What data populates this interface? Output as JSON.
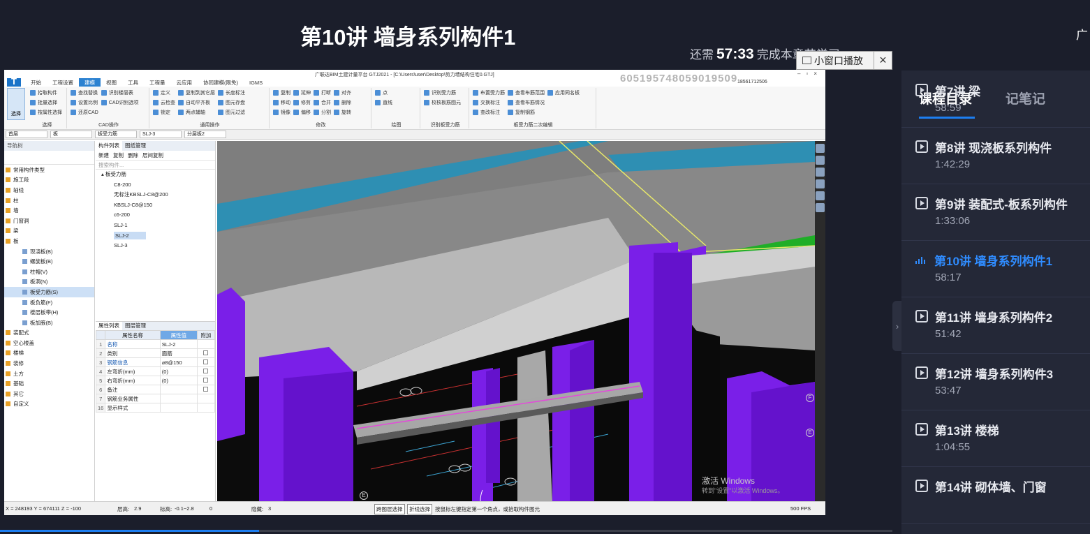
{
  "header": {
    "course_title": "第10讲 墙身系列构件1",
    "right_cut_text": "广",
    "remain_prefix": "还需",
    "remain_time": "57:33",
    "remain_suffix": "完成本章节学习",
    "pip_label": "小窗口播放",
    "pip_close": "×"
  },
  "app": {
    "title": "广联达BIM土建计量平台 GTJ2021 - [C:\\Users\\user\\Desktop\\剪力墙结构住宅0.GTJ]",
    "watermark": "605195748059019509",
    "phone": "18561712506",
    "logo": "T",
    "menu": [
      "开始",
      "工程设置",
      "建模",
      "视图",
      "工具",
      "工程量",
      "云应用",
      "协同建模(限免)",
      "IGMS"
    ],
    "active_menu": "建模",
    "ribbon_groups": [
      {
        "name": "选择",
        "rows": [
          "拾取构件",
          "批量选择",
          "按属性选择"
        ]
      },
      {
        "name": "CAD操作",
        "rows": [
          "查找替换",
          "设置比例",
          "还原CAD",
          "识别楼层表",
          "CAD识别选项"
        ]
      },
      {
        "name": "通用操作",
        "rows": [
          "定义",
          "云检查",
          "锁定",
          "复制到其它层",
          "自动平齐板",
          "两点辅轴",
          "长度标注",
          "图元存盘",
          "图元过滤"
        ]
      },
      {
        "name": "修改",
        "rows": [
          "复制",
          "移动",
          "镜像",
          "延伸",
          "修剪",
          "偏移",
          "打断",
          "合并",
          "分割",
          "对齐",
          "删除",
          "旋转"
        ]
      },
      {
        "name": "绘图",
        "rows": [
          "点",
          "直线"
        ]
      },
      {
        "name": "识别板受力筋",
        "rows": [
          "识别受力筋",
          "校核板筋图元"
        ]
      },
      {
        "name": "板受力筋二次编辑",
        "rows": [
          "布置受力筋",
          "交换标注",
          "查改标注",
          "查看布筋范围",
          "查看布筋情况",
          "复制钢筋",
          "应用同名板"
        ]
      }
    ],
    "select_label": "选择",
    "dropdowns": [
      "首层",
      "板",
      "板受力筋",
      "SLJ-3",
      "分层板2"
    ]
  },
  "navtree": {
    "header": "导航树",
    "items": [
      {
        "label": "常用构件类型",
        "sub": false
      },
      {
        "label": "施工段",
        "sub": false
      },
      {
        "label": "轴线",
        "sub": false
      },
      {
        "label": "柱",
        "sub": false
      },
      {
        "label": "墙",
        "sub": false
      },
      {
        "label": "门窗洞",
        "sub": false
      },
      {
        "label": "梁",
        "sub": false
      },
      {
        "label": "板",
        "sub": false
      },
      {
        "label": "现浇板(B)",
        "sub": true
      },
      {
        "label": "螺旋板(B)",
        "sub": true
      },
      {
        "label": "柱帽(V)",
        "sub": true
      },
      {
        "label": "板洞(N)",
        "sub": true
      },
      {
        "label": "板受力筋(S)",
        "sub": true,
        "selected": true
      },
      {
        "label": "板负筋(F)",
        "sub": true
      },
      {
        "label": "楼层板带(H)",
        "sub": true
      },
      {
        "label": "板加腋(B)",
        "sub": true
      },
      {
        "label": "装配式",
        "sub": false
      },
      {
        "label": "空心楼盖",
        "sub": false
      },
      {
        "label": "楼梯",
        "sub": false
      },
      {
        "label": "装修",
        "sub": false
      },
      {
        "label": "土方",
        "sub": false
      },
      {
        "label": "基础",
        "sub": false
      },
      {
        "label": "其它",
        "sub": false
      },
      {
        "label": "自定义",
        "sub": false
      }
    ]
  },
  "complist": {
    "tabs": [
      "构件列表",
      "图纸管理"
    ],
    "actions": [
      "新建",
      "复制",
      "删除",
      "层间复制"
    ],
    "search_placeholder": "搜索构件...",
    "root": "板受力筋",
    "items": [
      "C8-200",
      "无标注KBSLJ-C8@200",
      "KBSLJ-C8@150",
      "c6-200",
      "SLJ-1",
      "SLJ-2",
      "SLJ-3"
    ],
    "selected": "SLJ-2"
  },
  "props": {
    "tabs": [
      "属性列表",
      "图层管理"
    ],
    "columns": [
      "属性名称",
      "属性值",
      "附加"
    ],
    "rows": [
      {
        "n": "1",
        "name": "名称",
        "value": "SLJ-2",
        "blue": true,
        "cb": false
      },
      {
        "n": "2",
        "name": "类别",
        "value": "面筋",
        "blue": false,
        "cb": true
      },
      {
        "n": "3",
        "name": "钢筋信息",
        "value": "⌀8@150",
        "blue": true,
        "cb": true
      },
      {
        "n": "4",
        "name": "左弯折(mm)",
        "value": "(0)",
        "blue": false,
        "cb": true
      },
      {
        "n": "5",
        "name": "右弯折(mm)",
        "value": "(0)",
        "blue": false,
        "cb": true
      },
      {
        "n": "6",
        "name": "备注",
        "value": "",
        "blue": false,
        "cb": true
      },
      {
        "n": "7",
        "name": "钢筋业务属性",
        "value": "",
        "blue": false,
        "cb": false
      },
      {
        "n": "16",
        "name": "显示样式",
        "value": "",
        "blue": false,
        "cb": false
      }
    ]
  },
  "viewport": {
    "axis_labels": [
      "F",
      "E",
      "E"
    ]
  },
  "statusbar": {
    "coords": "X = 248193 Y = 674111 Z = -100",
    "floor_height_label": "层高:",
    "floor_height": "2.9",
    "elevation_label": "标高:",
    "elevation": "-0.1~2.8",
    "zero": "0",
    "hidden_label": "隐藏:",
    "hidden": "3",
    "cross_layer": "跨图层选择",
    "polyline": "折线选择",
    "hint": "按鼠标左键指定第一个角点，或拾取构件图元",
    "fps": "500 FPS"
  },
  "windows_activate": {
    "line1": "激活 Windows",
    "line2": "转到\"设置\"以激活 Windows。"
  },
  "progress": 0.29,
  "sidebar": {
    "tab_catalog": "课程目录",
    "tab_notes": "记笔记",
    "lessons": [
      {
        "title": "第7讲 梁",
        "duration": "58:59",
        "active": false
      },
      {
        "title": "第8讲 现浇板系列构件",
        "duration": "1:42:29",
        "active": false
      },
      {
        "title": "第9讲 装配式-板系列构件",
        "duration": "1:33:06",
        "active": false
      },
      {
        "title": "第10讲 墙身系列构件1",
        "duration": "58:17",
        "active": true
      },
      {
        "title": "第11讲 墙身系列构件2",
        "duration": "51:42",
        "active": false
      },
      {
        "title": "第12讲 墙身系列构件3",
        "duration": "53:47",
        "active": false
      },
      {
        "title": "第13讲 楼梯",
        "duration": "1:04:55",
        "active": false
      },
      {
        "title": "第14讲 砌体墙、门窗",
        "duration": "",
        "active": false
      }
    ]
  },
  "colors": {
    "accent": "#1d7ef0",
    "active_lesson": "#2f8cff",
    "background": "#1b1e2b",
    "sidebar": "#242837",
    "wall_purple": "#7a1fe8"
  }
}
